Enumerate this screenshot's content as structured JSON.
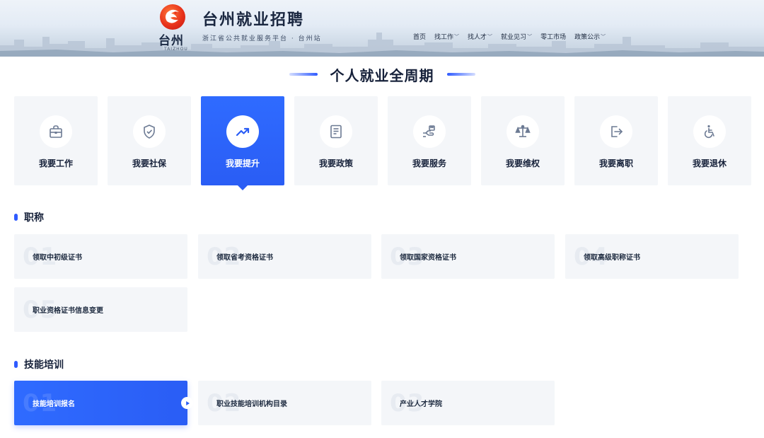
{
  "header": {
    "logo_text": "台州",
    "logo_sub": "TAIZHOU",
    "title": "台州就业招聘",
    "subtitle": "浙江省公共就业服务平台 · 台州站",
    "nav": [
      {
        "label": "首页",
        "has_menu": false
      },
      {
        "label": "找工作",
        "has_menu": true
      },
      {
        "label": "找人才",
        "has_menu": true
      },
      {
        "label": "就业见习",
        "has_menu": true
      },
      {
        "label": "零工市场",
        "has_menu": false
      },
      {
        "label": "政策公示",
        "has_menu": true
      }
    ]
  },
  "page_title": "个人就业全周期",
  "categories": [
    {
      "label": "我要工作",
      "icon": "briefcase-icon",
      "active": false
    },
    {
      "label": "我要社保",
      "icon": "shield-check-icon",
      "active": false
    },
    {
      "label": "我要提升",
      "icon": "trending-up-icon",
      "active": true
    },
    {
      "label": "我要政策",
      "icon": "document-icon",
      "active": false
    },
    {
      "label": "我要服务",
      "icon": "hand-service-icon",
      "active": false
    },
    {
      "label": "我要维权",
      "icon": "scale-icon",
      "active": false
    },
    {
      "label": "我要离职",
      "icon": "exit-icon",
      "active": false
    },
    {
      "label": "我要退休",
      "icon": "wheelchair-icon",
      "active": false
    }
  ],
  "groups": [
    {
      "title": "职称",
      "items": [
        {
          "num": "01",
          "label": "领取中初级证书"
        },
        {
          "num": "02",
          "label": "领取省考资格证书"
        },
        {
          "num": "03",
          "label": "领取国家资格证书"
        },
        {
          "num": "04",
          "label": "领取高级职称证书"
        },
        {
          "num": "05",
          "label": "职业资格证书信息变更"
        }
      ]
    },
    {
      "title": "技能培训",
      "items": [
        {
          "num": "01",
          "label": "技能培训报名",
          "active": true
        },
        {
          "num": "02",
          "label": "职业技能培训机构目录"
        },
        {
          "num": "03",
          "label": "产业人才学院"
        }
      ]
    }
  ],
  "colors": {
    "accent": "#2f6bff",
    "card_bg": "#f4f6f9",
    "text": "#16213a"
  }
}
